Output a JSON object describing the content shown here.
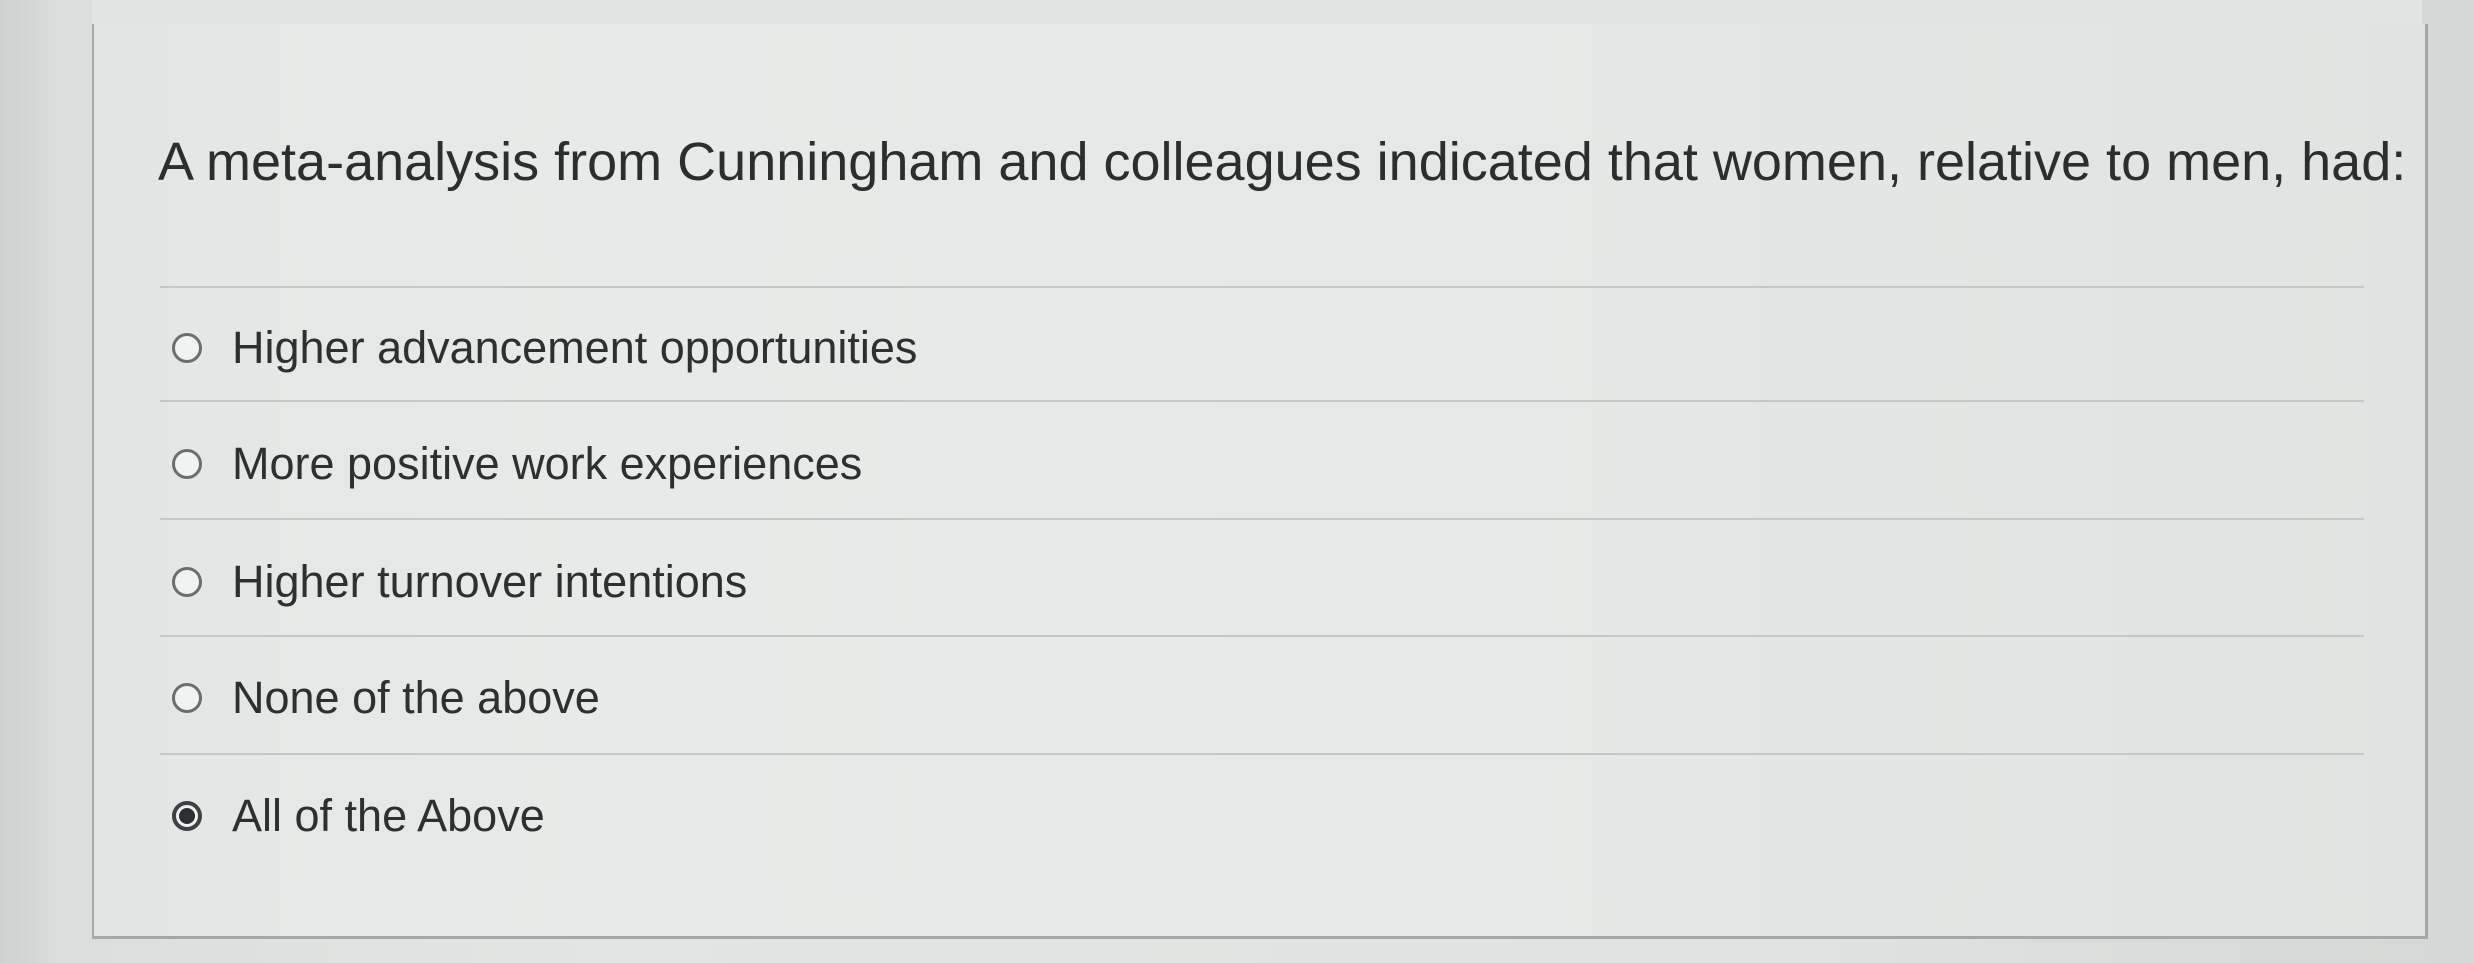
{
  "question": {
    "text": "A meta-analysis from Cunningham and colleagues indicated that women, relative to men, had:"
  },
  "answers": [
    {
      "label": "Higher advancement opportunities",
      "selected": false
    },
    {
      "label": "More positive work experiences",
      "selected": false
    },
    {
      "label": "Higher turnover intentions",
      "selected": false
    },
    {
      "label": "None of the above",
      "selected": false
    },
    {
      "label": "All of the Above",
      "selected": true
    }
  ],
  "colors": {
    "background": "#d8dad9",
    "card": "#e6e8e7",
    "text": "#2d2f31",
    "divider": "#c5c8c7",
    "radio_border": "#6b6e70"
  }
}
